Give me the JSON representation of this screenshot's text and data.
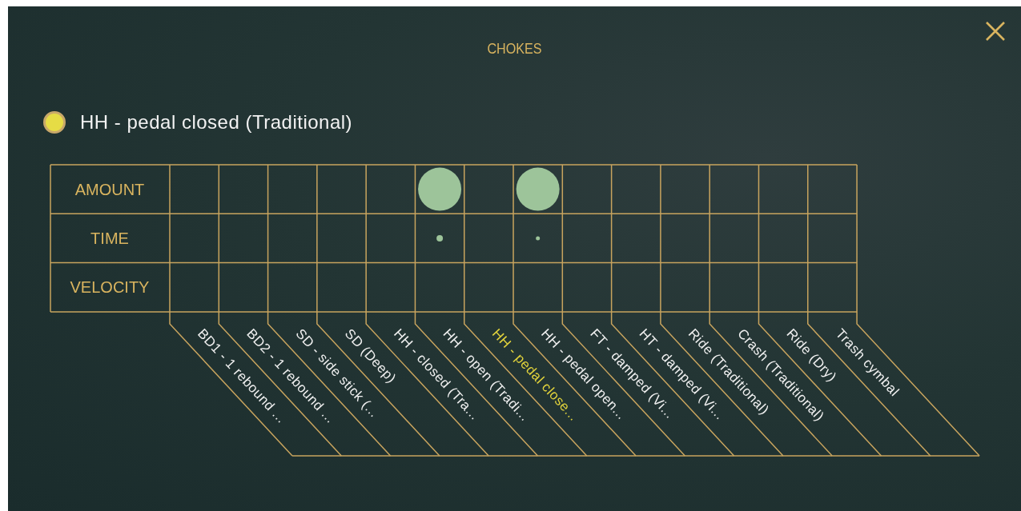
{
  "title": "CHOKES",
  "source": {
    "label": "HH - pedal closed (Traditional)",
    "selected": true
  },
  "rows": [
    "AMOUNT",
    "TIME",
    "VELOCITY"
  ],
  "columns": [
    {
      "label": "BD1 - 1 rebound ...",
      "selected": false
    },
    {
      "label": "BD2 - 1 rebound ...",
      "selected": false
    },
    {
      "label": "SD - side stick (...",
      "selected": false
    },
    {
      "label": "SD (Deep)",
      "selected": false
    },
    {
      "label": "HH - closed (Tra...",
      "selected": false
    },
    {
      "label": "HH - open (Tradi...",
      "selected": false,
      "dots": [
        {
          "kind": "large"
        },
        {
          "kind": "small"
        }
      ]
    },
    {
      "label": "HH - pedal close...",
      "selected": true
    },
    {
      "label": "HH - pedal open...",
      "selected": false,
      "dots": [
        {
          "kind": "large"
        },
        {
          "kind": "tiny"
        }
      ]
    },
    {
      "label": "FT - damped (Vi...",
      "selected": false
    },
    {
      "label": "HT - damped (Vi...",
      "selected": false
    },
    {
      "label": "Ride (Traditional)",
      "selected": false
    },
    {
      "label": "Crash (Traditional)",
      "selected": false
    },
    {
      "label": "Ride (Dry)",
      "selected": false
    },
    {
      "label": "Trash cymbal",
      "selected": false
    }
  ]
}
